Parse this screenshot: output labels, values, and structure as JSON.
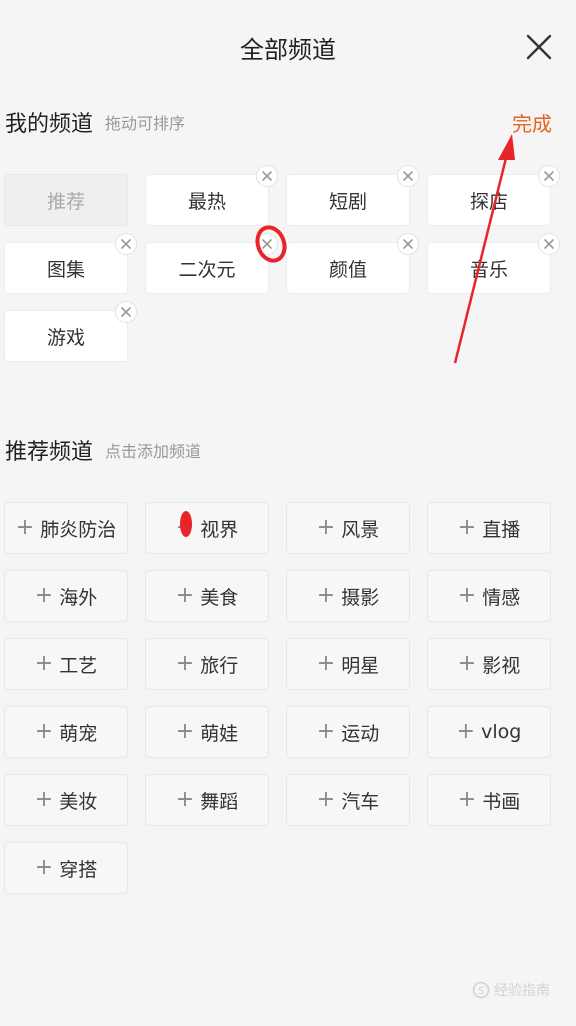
{
  "header": {
    "title": "全部频道",
    "close_icon": "close-icon"
  },
  "my_channels": {
    "title": "我的频道",
    "hint": "拖动可排序",
    "done_label": "完成",
    "items": [
      {
        "label": "推荐",
        "fixed": true
      },
      {
        "label": "最热"
      },
      {
        "label": "短剧"
      },
      {
        "label": "探店"
      },
      {
        "label": "图集"
      },
      {
        "label": "二次元"
      },
      {
        "label": "颜值"
      },
      {
        "label": "音乐"
      },
      {
        "label": "游戏"
      }
    ]
  },
  "recommended_channels": {
    "title": "推荐频道",
    "hint": "点击添加频道",
    "items": [
      "肺炎防治",
      "视界",
      "风景",
      "直播",
      "海外",
      "美食",
      "摄影",
      "情感",
      "工艺",
      "旅行",
      "明星",
      "影视",
      "萌宠",
      "萌娃",
      "运动",
      "vlog",
      "美妆",
      "舞蹈",
      "汽车",
      "书画",
      "穿搭"
    ]
  },
  "watermark": "经验指南",
  "colors": {
    "accent": "#e8631c",
    "annotation": "#e8242a"
  }
}
